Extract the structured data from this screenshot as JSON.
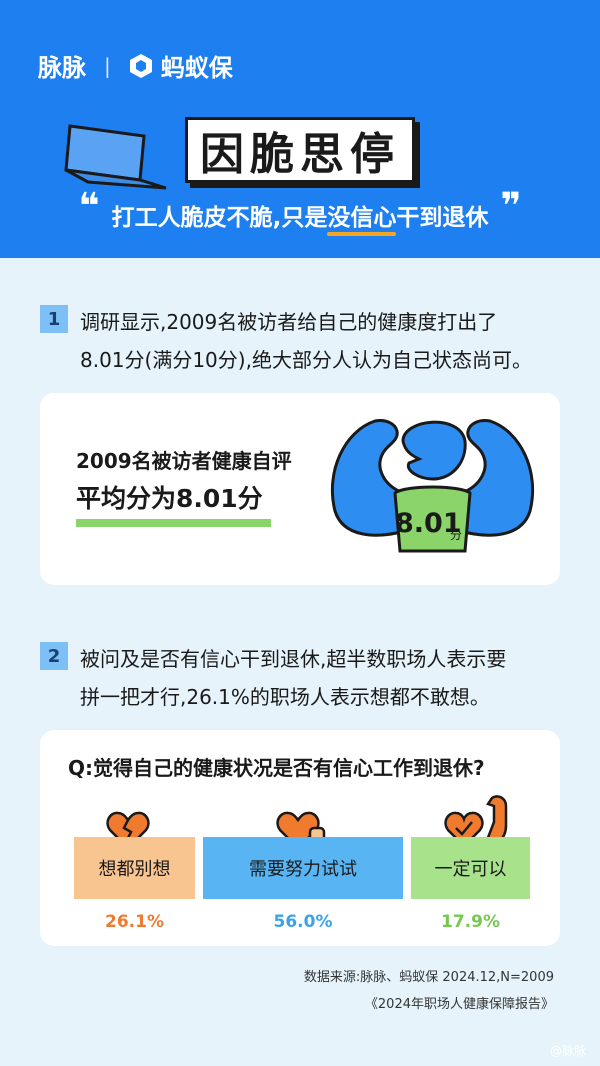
{
  "header": {
    "brand_left": "脉脉",
    "brand_sep": "|",
    "brand_right": "蚂蚁保",
    "title": "因脆思停",
    "subtitle_pre": "打工人脆皮不脆,只是",
    "subtitle_highlight": "没信心",
    "subtitle_post": "干到退休",
    "quote_open": "❝",
    "quote_close": "❞"
  },
  "section1": {
    "num": "1",
    "text_line1": "调研显示,2009名被访者给自己的健康度打出了",
    "text_line2": "8.01分(满分10分),绝大部分人认为自己状态尚可。"
  },
  "card1": {
    "label": "2009名被访者健康自评",
    "headline": "平均分为8.01分",
    "score": "8.01",
    "score_unit": "分"
  },
  "section2": {
    "num": "2",
    "text_line1": "被问及是否有信心干到退休,超半数职场人表示要",
    "text_line2": "拼一把才行,26.1%的职场人表示想都不敢想。"
  },
  "card2": {
    "question": "Q:觉得自己的健康状况是否有信心工作到退休?",
    "options": [
      {
        "label": "想都别想",
        "pct": "26.1%",
        "pct_value": 26.1,
        "color": "#f8c48f",
        "icon": "broken-heart-icon"
      },
      {
        "label": "需要努力试试",
        "pct": "56.0%",
        "pct_value": 56.0,
        "color": "#58b4f3",
        "icon": "heart-fist-icon"
      },
      {
        "label": "一定可以",
        "pct": "17.9%",
        "pct_value": 17.9,
        "color": "#a8e38b",
        "icon": "strong-arm-heart-icon"
      }
    ]
  },
  "source": {
    "line1": "数据来源:脉脉、蚂蚁保 2024.12,N=2009",
    "line2": "《2024年职场人健康保障报告》"
  },
  "watermark": "@脉脉",
  "colors": {
    "header_bg": "#1e7ff0",
    "page_bg": "#e6f3fb",
    "accent_orange": "#f6a623",
    "green": "#8bd46a"
  }
}
